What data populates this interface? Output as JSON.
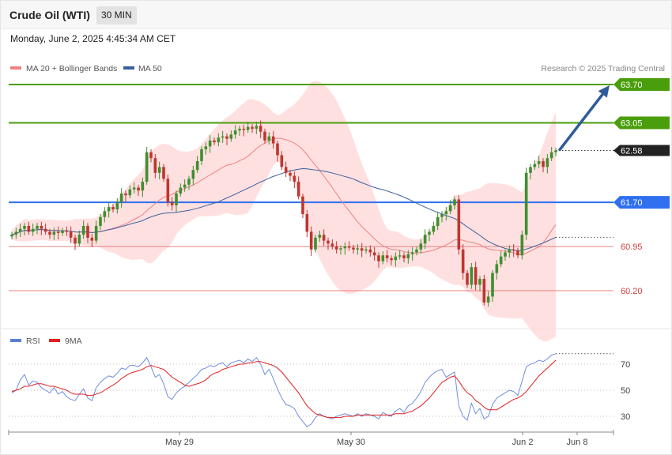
{
  "header": {
    "instrument": "Crude Oil (WTI)",
    "timeframe": "30 MIN"
  },
  "timestamp": "Monday, June 2, 2025 4:45:34 AM CET",
  "legend": [
    {
      "label": "MA 20 + Bollinger Bands",
      "color": "#f08080"
    },
    {
      "label": "MA 50",
      "color": "#3a5f9e"
    }
  ],
  "credit": "Research © 2025 Trading Central",
  "rsi_legend": [
    {
      "label": "RSI",
      "color": "#5b7fd4"
    },
    {
      "label": "9MA",
      "color": "#e02020"
    }
  ],
  "chart_data": [
    {
      "type": "candlestick",
      "ylim": [
        59.6,
        64.0
      ],
      "x_ticks": [
        "May 29",
        "May 30",
        "Jun 2",
        "Jun 8"
      ],
      "current_price": "62.58",
      "levels": [
        {
          "label": "63.70",
          "value": 63.7,
          "kind": "resistance",
          "color": "#4a9e0c"
        },
        {
          "label": "63.05",
          "value": 63.05,
          "kind": "resistance",
          "color": "#4a9e0c"
        },
        {
          "label": "62.58",
          "value": 62.58,
          "kind": "last",
          "color": "#222222"
        },
        {
          "label": "61.70",
          "value": 61.7,
          "kind": "pivot",
          "color": "#2f6ff0"
        },
        {
          "label": "60.95",
          "value": 60.95,
          "kind": "support",
          "color": "#e88080"
        },
        {
          "label": "60.20",
          "value": 60.2,
          "kind": "support",
          "color": "#e88080"
        }
      ],
      "forecast_arrow": {
        "from": 62.58,
        "to": 63.7
      },
      "close": [
        61.15,
        61.2,
        61.25,
        61.3,
        61.2,
        61.25,
        61.3,
        61.25,
        61.2,
        61.15,
        61.2,
        61.18,
        61.22,
        61.2,
        61.1,
        61.0,
        61.15,
        61.3,
        61.1,
        61.05,
        61.3,
        61.45,
        61.55,
        61.62,
        61.58,
        61.7,
        61.85,
        61.82,
        61.92,
        61.95,
        61.9,
        62.05,
        62.55,
        62.45,
        62.2,
        62.3,
        62.1,
        61.7,
        61.65,
        61.85,
        61.95,
        62.0,
        62.1,
        62.25,
        62.4,
        62.6,
        62.65,
        62.75,
        62.72,
        62.8,
        62.82,
        62.78,
        62.85,
        62.92,
        62.95,
        62.93,
        62.98,
        62.95,
        63.0,
        62.9,
        62.75,
        62.82,
        62.7,
        62.5,
        62.3,
        62.2,
        62.15,
        62.05,
        61.8,
        61.5,
        61.2,
        60.9,
        61.1,
        61.15,
        61.05,
        61.0,
        60.95,
        60.9,
        60.92,
        60.95,
        60.93,
        60.9,
        60.92,
        60.88,
        60.9,
        60.85,
        60.8,
        60.7,
        60.8,
        60.75,
        60.72,
        60.78,
        60.8,
        60.75,
        60.82,
        60.85,
        60.9,
        61.0,
        61.15,
        61.2,
        61.3,
        61.45,
        61.5,
        61.55,
        61.65,
        61.75,
        60.9,
        60.5,
        60.3,
        60.6,
        60.3,
        60.4,
        60.0,
        60.1,
        60.5,
        60.65,
        60.78,
        60.85,
        60.9,
        60.88,
        60.8,
        61.15,
        62.2,
        62.3,
        62.35,
        62.4,
        62.3,
        62.45,
        62.55,
        62.58
      ]
    },
    {
      "type": "line",
      "title": "RSI",
      "ylim": [
        20,
        80
      ],
      "y_ticks": [
        70,
        50,
        30
      ],
      "series": [
        {
          "name": "RSI",
          "values": [
            48,
            50,
            58,
            62,
            54,
            57,
            56,
            52,
            50,
            48,
            52,
            47,
            49,
            45,
            43,
            42,
            47,
            51,
            44,
            42,
            52,
            56,
            59,
            61,
            60,
            63,
            67,
            66,
            69,
            69,
            68,
            71,
            75,
            68,
            60,
            62,
            55,
            45,
            43,
            48,
            51,
            53,
            56,
            59,
            62,
            66,
            67,
            69,
            68,
            70,
            71,
            68,
            71,
            72,
            73,
            71,
            74,
            72,
            75,
            70,
            62,
            66,
            59,
            51,
            44,
            39,
            38,
            36,
            30,
            26,
            22,
            24,
            29,
            32,
            30,
            29,
            28,
            30,
            31,
            32,
            31,
            30,
            32,
            30,
            32,
            31,
            30,
            28,
            33,
            31,
            30,
            34,
            36,
            33,
            38,
            40,
            44,
            49,
            56,
            60,
            63,
            65,
            66,
            60,
            62,
            64,
            38,
            30,
            27,
            40,
            32,
            36,
            28,
            30,
            39,
            44,
            46,
            48,
            50,
            49,
            46,
            57,
            68,
            70,
            71,
            73,
            72,
            74,
            77,
            78
          ]
        },
        {
          "name": "9MA",
          "values": [
            49,
            50,
            51,
            53,
            53,
            54,
            55,
            55,
            54,
            53,
            53,
            52,
            51,
            50,
            48,
            47,
            47,
            47,
            46,
            46,
            47,
            48,
            50,
            52,
            54,
            56,
            59,
            61,
            63,
            64,
            65,
            66,
            68,
            69,
            68,
            67,
            66,
            63,
            60,
            58,
            56,
            54,
            53,
            54,
            55,
            56,
            58,
            61,
            63,
            64,
            66,
            67,
            68,
            69,
            70,
            70,
            71,
            71,
            72,
            72,
            71,
            70,
            69,
            67,
            64,
            60,
            56,
            52,
            48,
            43,
            38,
            35,
            32,
            31,
            30,
            29,
            29,
            29,
            29,
            30,
            30,
            30,
            31,
            31,
            31,
            31,
            31,
            31,
            31,
            31,
            31,
            32,
            32,
            32,
            33,
            34,
            36,
            38,
            41,
            44,
            48,
            52,
            56,
            58,
            60,
            61,
            57,
            52,
            48,
            46,
            42,
            40,
            37,
            35,
            35,
            35,
            37,
            39,
            41,
            43,
            44,
            46,
            49,
            53,
            57,
            61,
            64,
            67,
            70,
            73
          ]
        }
      ]
    }
  ]
}
